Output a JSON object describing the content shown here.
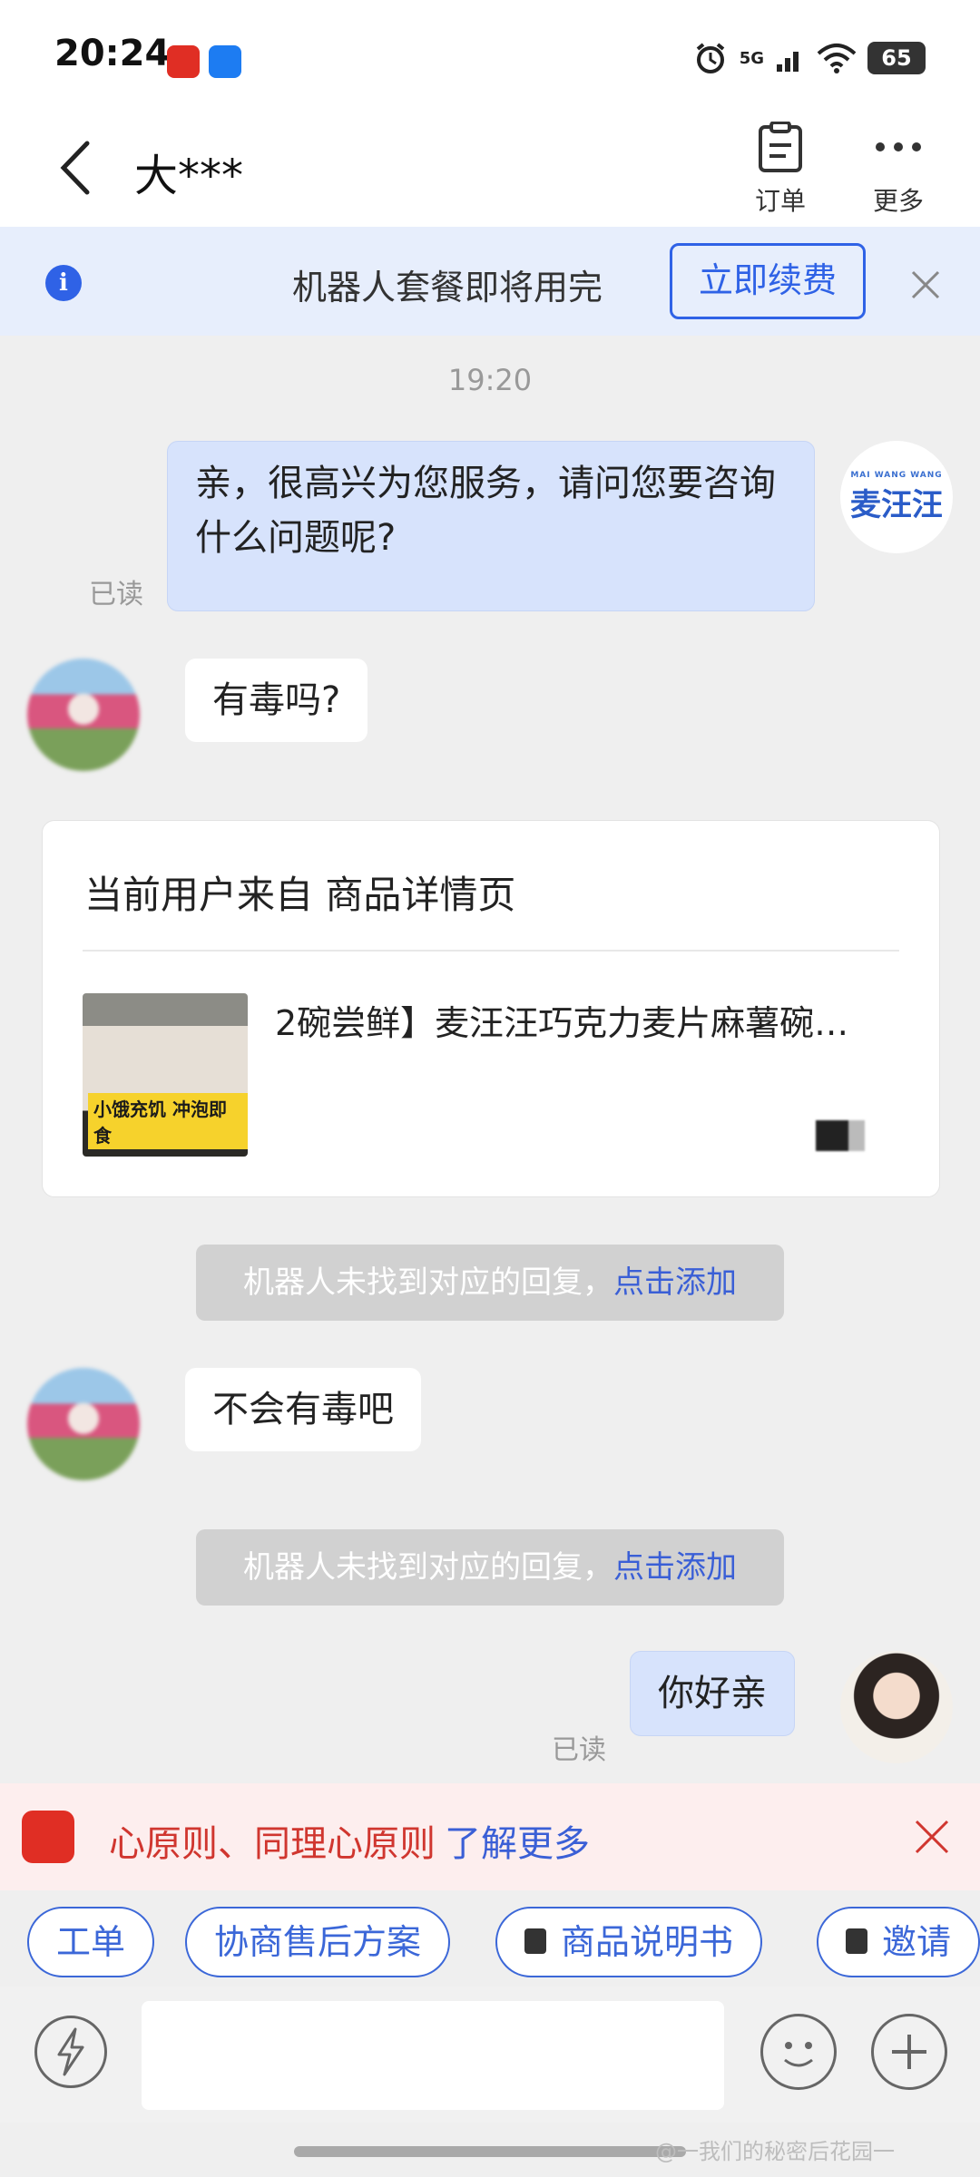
{
  "status_bar": {
    "time": "20:24",
    "network": "5G",
    "battery": "65"
  },
  "header": {
    "title": "大***",
    "actions": {
      "order_label": "订单",
      "more_label": "更多"
    }
  },
  "banner": {
    "text": "机器人套餐即将用完",
    "button": "立即续费",
    "icon": "info-icon"
  },
  "chat": {
    "time": "19:20",
    "brand_avatar": {
      "small": "MAI WANG WANG",
      "big": "麦汪汪"
    },
    "messages": [
      {
        "text": "亲，很高兴为您服务，请问您要咨询什么问题呢?",
        "status": "已读"
      },
      {
        "text": "有毒吗?"
      },
      {
        "text": "不会有毒吧"
      },
      {
        "text": "你好亲",
        "status": "已读"
      }
    ],
    "product_card": {
      "title": "当前用户来自 商品详情页",
      "name": "2碗尝鲜】麦汪汪巧克力麦片麻薯碗…",
      "image_tag": "小饿充饥 冲泡即食"
    },
    "system_notices": [
      {
        "text": "机器人未找到对应的回复，",
        "link": "点击添加"
      },
      {
        "text": "机器人未找到对应的回复，",
        "link": "点击添加"
      }
    ]
  },
  "tip_bar": {
    "text": "心原则、同理心原则",
    "link": "了解更多"
  },
  "quick_chips": [
    "工单",
    "协商售后方案",
    "商品说明书",
    "邀请"
  ],
  "watermark_credit": "@一我们的秘密后花园一",
  "colors": {
    "accent": "#2f62e6",
    "tip_red": "#d0362f",
    "bubble_out": "#d7e3fc"
  }
}
